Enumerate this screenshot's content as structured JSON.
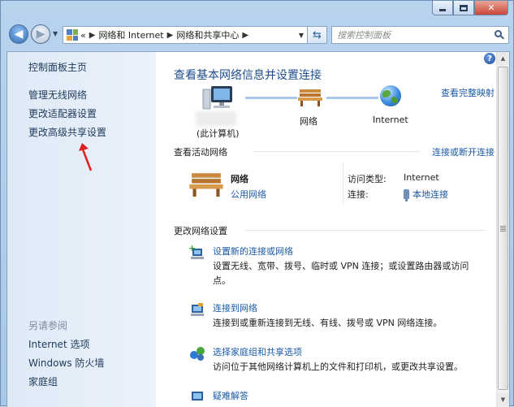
{
  "address_bar": {
    "history_prefix": "«",
    "crumbs": [
      "网络和 Internet",
      "网络和共享中心"
    ]
  },
  "search": {
    "placeholder": "搜索控制面板"
  },
  "sidebar": {
    "home": "控制面板主页",
    "links": [
      "管理无线网络",
      "更改适配器设置",
      "更改高级共享设置"
    ],
    "see_also_heading": "另请参阅",
    "see_also": [
      "Internet 选项",
      "Windows 防火墙",
      "家庭组"
    ]
  },
  "main": {
    "title": "查看基本网络信息并设置连接",
    "full_map_link": "查看完整映射",
    "map": {
      "computer_label": "(此计算机)",
      "network_label": "网络",
      "internet_label": "Internet"
    },
    "active_section": {
      "heading": "查看活动网络",
      "connect_link": "连接或断开连接",
      "network_name": "网络",
      "network_type": "公用网络",
      "access_type_key": "访问类型:",
      "access_type_value": "Internet",
      "connections_key": "连接:",
      "connections_value": "本地连接"
    },
    "change_section": {
      "heading": "更改网络设置",
      "tasks": [
        {
          "link": "设置新的连接或网络",
          "desc": "设置无线、宽带、拨号、临时或 VPN 连接；或设置路由器或访问点。"
        },
        {
          "link": "连接到网络",
          "desc": "连接到或重新连接到无线、有线、拨号或 VPN 网络连接。"
        },
        {
          "link": "选择家庭组和共享选项",
          "desc": "访问位于其他网络计算机上的文件和打印机，或更改共享设置。"
        },
        {
          "link": "疑难解答",
          "desc": ""
        }
      ]
    }
  },
  "colors": {
    "link": "#1a5aa8",
    "title": "#1e4d8c",
    "sidebar_bg": "#dfeaf7",
    "pointer_arrow": "#e02020"
  },
  "icons": [
    "back-arrow-icon",
    "forward-arrow-icon",
    "control-panel-icon",
    "refresh-icon",
    "search-icon",
    "help-icon",
    "computer-icon",
    "bench-network-icon",
    "globe-icon",
    "plug-icon",
    "red-pointer-arrow"
  ]
}
